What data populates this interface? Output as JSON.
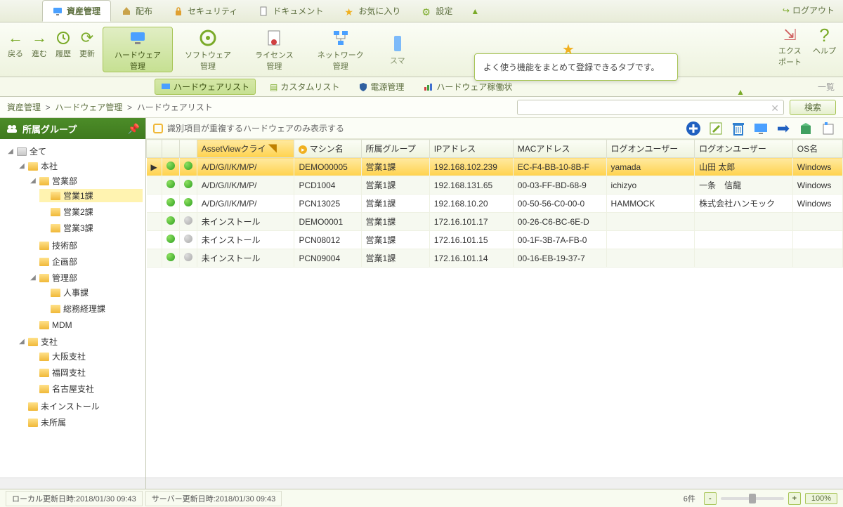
{
  "tabs": {
    "asset": "資産管理",
    "distribute": "配布",
    "security": "セキュリティ",
    "document": "ドキュメント",
    "favorite": "お気に入り",
    "settings": "設定",
    "logout": "ログアウト"
  },
  "nav": {
    "back": "戻る",
    "forward": "進む",
    "history": "履歴",
    "refresh": "更新"
  },
  "ribbon": {
    "hardware": "ハードウェア\n管理",
    "software": "ソフトウェア\n管理",
    "license": "ライセンス\n管理",
    "network": "ネットワーク\n管理",
    "smart": "スマ",
    "export": "エクス\nポート",
    "help": "ヘルプ"
  },
  "tooltip": "よく使う機能をまとめて登録できるタブです。",
  "sub": {
    "hwlist": "ハードウェアリスト",
    "custom": "カスタムリスト",
    "power": "電源管理",
    "oprate": "ハードウェア稼働状",
    "trailing": "一覧"
  },
  "crumb": {
    "a": "資産管理",
    "b": "ハードウェア管理",
    "c": "ハードウェアリスト"
  },
  "search_btn": "検索",
  "sidebar_title": "所属グループ",
  "tree": {
    "all": "全て",
    "honsha": "本社",
    "eigyobu": "営業部",
    "eigyo1": "営業1課",
    "eigyo2": "営業2課",
    "eigyo3": "営業3課",
    "gijutsu": "技術部",
    "kikaku": "企画部",
    "kanri": "管理部",
    "jinji": "人事課",
    "soumu": "総務経理課",
    "mdm": "MDM",
    "shisha": "支社",
    "osaka": "大阪支社",
    "fukuoka": "福岡支社",
    "nagoya": "名古屋支社",
    "miinst": "未インストール",
    "mishozoku": "未所属"
  },
  "filter_label": "識別項目が重複するハードウェアのみ表示する",
  "columns": {
    "c1": "",
    "c2": "",
    "c3": "",
    "client": "AssetViewクライ",
    "machine": "マシン名",
    "group": "所属グループ",
    "ip": "IPアドレス",
    "mac": "MACアドレス",
    "logon_user": "ログオンユーザー",
    "logon_user2": "ログオンユーザー",
    "os": "OS名"
  },
  "rows": [
    {
      "sel": true,
      "s1": "g",
      "s2": "g",
      "client": "A/D/G/I/K/M/P/",
      "machine": "DEMO00005",
      "group": "営業1課",
      "ip": "192.168.102.239",
      "mac": "EC-F4-BB-10-8B-F",
      "u1": "yamada",
      "u2": "山田 太郎",
      "os": "Windows"
    },
    {
      "sel": false,
      "s1": "g",
      "s2": "g",
      "client": "A/D/G/I/K/M/P/",
      "machine": "PCD1004",
      "group": "営業1課",
      "ip": "192.168.131.65",
      "mac": "00-03-FF-BD-68-9",
      "u1": "ichizyo",
      "u2": "一条　信龍",
      "os": "Windows"
    },
    {
      "sel": false,
      "s1": "g",
      "s2": "g",
      "client": "A/D/G/I/K/M/P/",
      "machine": "PCN13025",
      "group": "営業1課",
      "ip": "192.168.10.20",
      "mac": "00-50-56-C0-00-0",
      "u1": "HAMMOCK",
      "u2": "株式会社ハンモック",
      "os": "Windows"
    },
    {
      "sel": false,
      "s1": "g",
      "s2": "x",
      "client": "未インストール",
      "machine": "DEMO0001",
      "group": "営業1課",
      "ip": "172.16.101.17",
      "mac": "00-26-C6-BC-6E-D",
      "u1": "",
      "u2": "",
      "os": ""
    },
    {
      "sel": false,
      "s1": "g",
      "s2": "x",
      "client": "未インストール",
      "machine": "PCN08012",
      "group": "営業1課",
      "ip": "172.16.101.15",
      "mac": "00-1F-3B-7A-FB-0",
      "u1": "",
      "u2": "",
      "os": ""
    },
    {
      "sel": false,
      "s1": "g",
      "s2": "x",
      "client": "未インストール",
      "machine": "PCN09004",
      "group": "営業1課",
      "ip": "172.16.101.14",
      "mac": "00-16-EB-19-37-7",
      "u1": "",
      "u2": "",
      "os": ""
    }
  ],
  "status": {
    "local": "ローカル更新日時:2018/01/30 09:43",
    "server": "サーバー更新日時:2018/01/30 09:43",
    "count": "6件",
    "zoom": "100%"
  }
}
